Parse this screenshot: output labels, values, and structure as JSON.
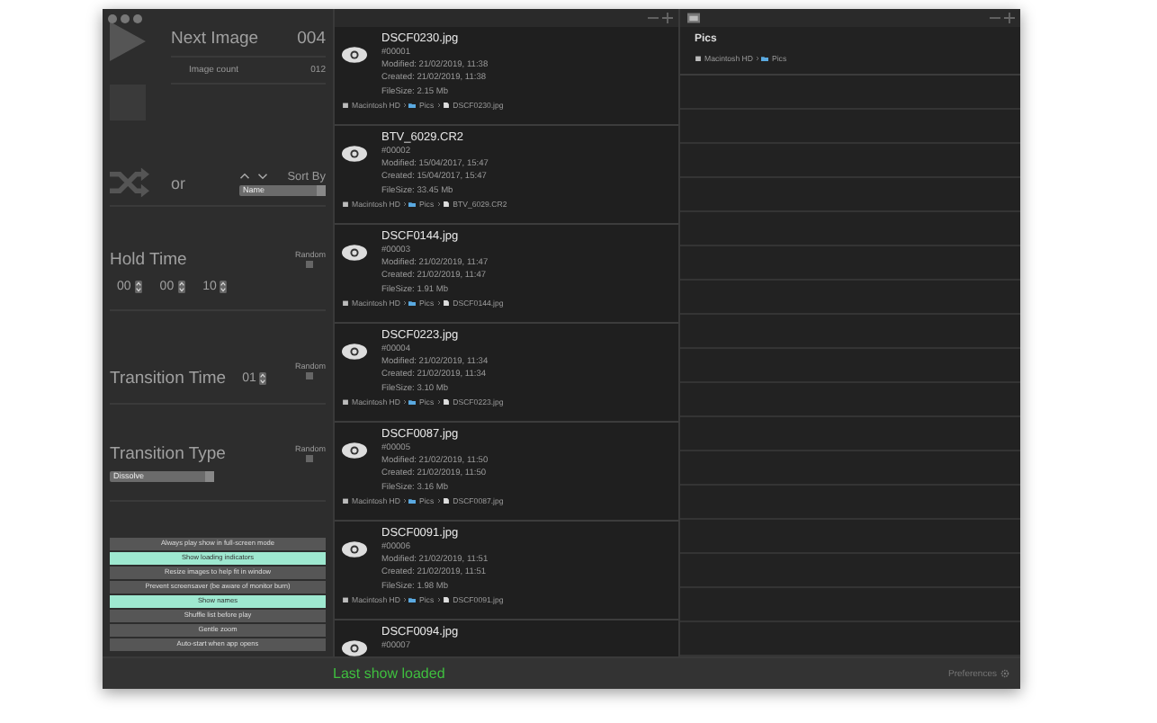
{
  "player": {
    "next_image_label": "Next Image",
    "next_image": "004",
    "image_count_label": "Image count",
    "image_count": "012",
    "or_label": "or",
    "sort_by_label": "Sort By",
    "sort_field": "Name"
  },
  "hold_time": {
    "label": "Hold Time",
    "random_label": "Random",
    "random": false,
    "fields": [
      "00",
      "00",
      "10"
    ]
  },
  "transition_time": {
    "label": "Transition Time",
    "random_label": "Random",
    "random": false,
    "fields": [
      "01"
    ]
  },
  "transition_type": {
    "label": "Transition Type",
    "random_label": "Random",
    "random": false,
    "value": "Dissolve"
  },
  "options": [
    {
      "label": "Always play show in full-screen mode",
      "selected": false
    },
    {
      "label": "Show loading indicators",
      "selected": true
    },
    {
      "label": "Resize images to help fit in window",
      "selected": false
    },
    {
      "label": "Prevent screensaver (be aware of monitor burn)",
      "selected": false
    },
    {
      "label": "Show names",
      "selected": true
    },
    {
      "label": "Shuffle list before play",
      "selected": false
    },
    {
      "label": "Gentle zoom",
      "selected": false
    },
    {
      "label": "Auto-start when app opens",
      "selected": false
    }
  ],
  "files": [
    {
      "name": "DSCF0230.jpg",
      "number": "#00001",
      "modified": "Modified: 21/02/2019, 11:38",
      "created": "Created:  21/02/2019, 11:38",
      "filesize": "FileSize:  2.15 Mb",
      "path": [
        "Macintosh HD",
        "Pics",
        "DSCF0230.jpg"
      ]
    },
    {
      "name": "BTV_6029.CR2",
      "number": "#00002",
      "modified": "Modified: 15/04/2017, 15:47",
      "created": "Created:  15/04/2017, 15:47",
      "filesize": "FileSize:  33.45 Mb",
      "path": [
        "Macintosh HD",
        "Pics",
        "BTV_6029.CR2"
      ]
    },
    {
      "name": "DSCF0144.jpg",
      "number": "#00003",
      "modified": "Modified: 21/02/2019, 11:47",
      "created": "Created:  21/02/2019, 11:47",
      "filesize": "FileSize:  1.91 Mb",
      "path": [
        "Macintosh HD",
        "Pics",
        "DSCF0144.jpg"
      ]
    },
    {
      "name": "DSCF0223.jpg",
      "number": "#00004",
      "modified": "Modified: 21/02/2019, 11:34",
      "created": "Created:  21/02/2019, 11:34",
      "filesize": "FileSize:  3.10 Mb",
      "path": [
        "Macintosh HD",
        "Pics",
        "DSCF0223.jpg"
      ]
    },
    {
      "name": "DSCF0087.jpg",
      "number": "#00005",
      "modified": "Modified: 21/02/2019, 11:50",
      "created": "Created:  21/02/2019, 11:50",
      "filesize": "FileSize:  3.16 Mb",
      "path": [
        "Macintosh HD",
        "Pics",
        "DSCF0087.jpg"
      ]
    },
    {
      "name": "DSCF0091.jpg",
      "number": "#00006",
      "modified": "Modified: 21/02/2019, 11:51",
      "created": "Created:  21/02/2019, 11:51",
      "filesize": "FileSize:  1.98 Mb",
      "path": [
        "Macintosh HD",
        "Pics",
        "DSCF0091.jpg"
      ]
    },
    {
      "name": "DSCF0094.jpg",
      "number": "#00007"
    }
  ],
  "folder": {
    "title": "Pics",
    "path": [
      "Macintosh HD",
      "Pics"
    ]
  },
  "status": "Last show loaded",
  "preferences": "Preferences"
}
